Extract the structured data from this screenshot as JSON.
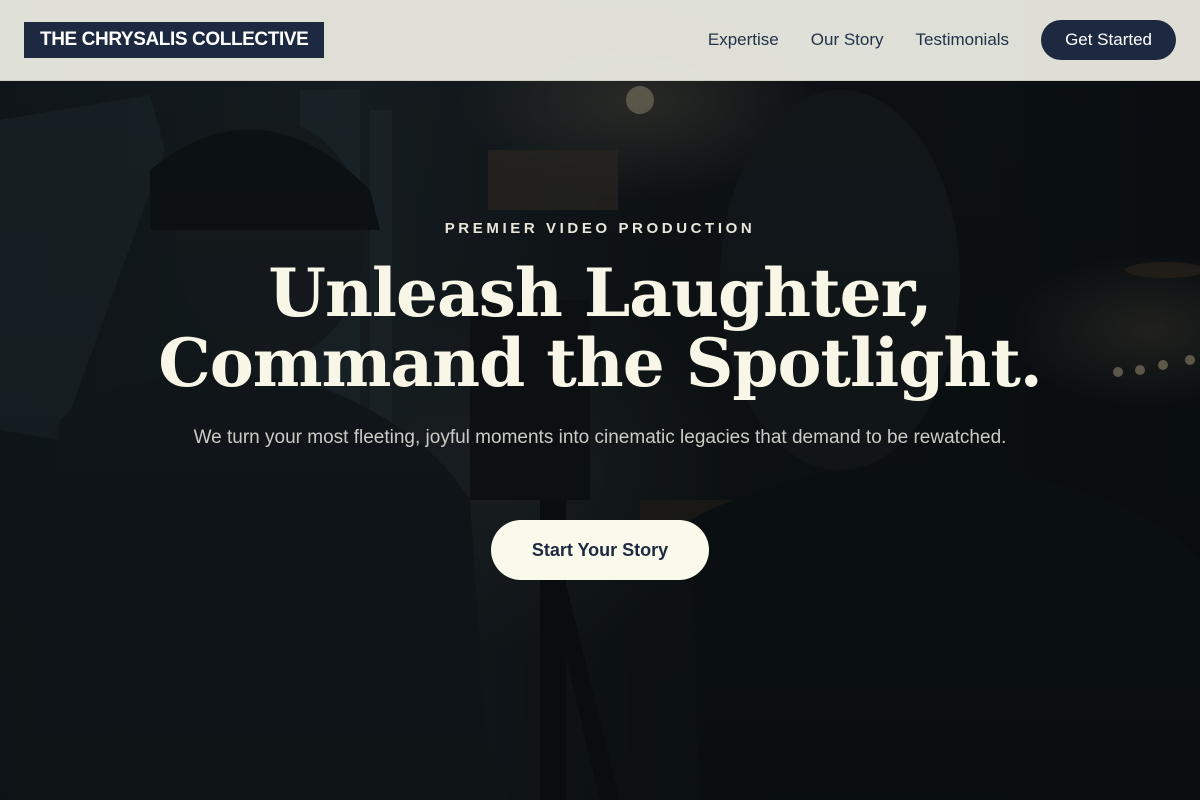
{
  "header": {
    "brand": "THE CHRYSALIS COLLECTIVE",
    "nav": [
      {
        "label": "Expertise"
      },
      {
        "label": "Our Story"
      },
      {
        "label": "Testimonials"
      }
    ],
    "cta_label": "Get Started"
  },
  "hero": {
    "eyebrow": "PREMIER VIDEO PRODUCTION",
    "headline_line1": "Unleash Laughter,",
    "headline_line2": "Command the Spotlight.",
    "subtext": "We turn your most fleeting, joyful moments into cinematic legacies that demand to be rewatched.",
    "cta_label": "Start Your Story",
    "background_image": "film-crew-silhouettes"
  },
  "colors": {
    "navy": "#1d2940",
    "header_bg": "#ecece2",
    "cream": "#f8f6e6",
    "button_cream": "#fafaec"
  }
}
